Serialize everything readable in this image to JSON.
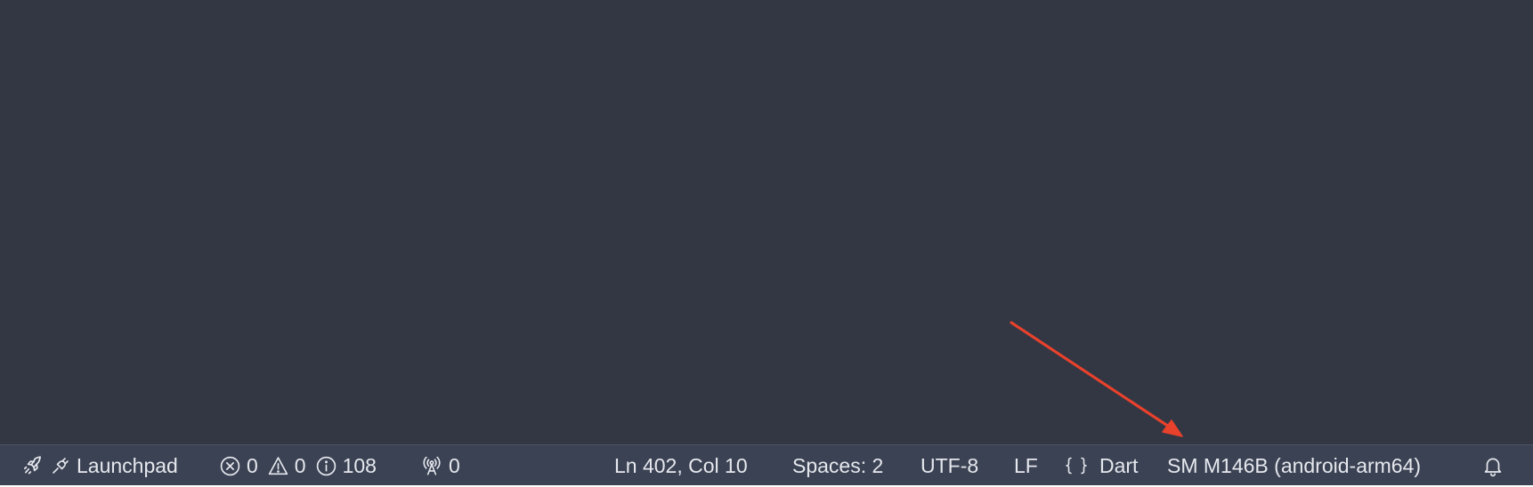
{
  "statusbar": {
    "launchpad": {
      "icons": [
        "rocket-icon",
        "plug-icon"
      ],
      "label": "Launchpad"
    },
    "problems": {
      "errors": {
        "icon": "error-circle-icon",
        "count": "0"
      },
      "warnings": {
        "icon": "warning-triangle-icon",
        "count": "0"
      },
      "infos": {
        "icon": "info-circle-icon",
        "count": "108"
      }
    },
    "ports": {
      "icon": "broadcast-antenna-icon",
      "count": "0"
    },
    "cursor_position": "Ln 402, Col 10",
    "indentation": "Spaces: 2",
    "encoding": "UTF-8",
    "line_ending": "LF",
    "language": {
      "icon": "braces-icon",
      "label": "Dart"
    },
    "device": "SM M146B (android-arm64)",
    "notifications": {
      "icon": "bell-icon"
    }
  },
  "colors": {
    "editor_background": "#323743",
    "statusbar_background": "#3b4253",
    "statusbar_text": "#e6e8ee",
    "annotation_arrow": "#e8412c"
  }
}
